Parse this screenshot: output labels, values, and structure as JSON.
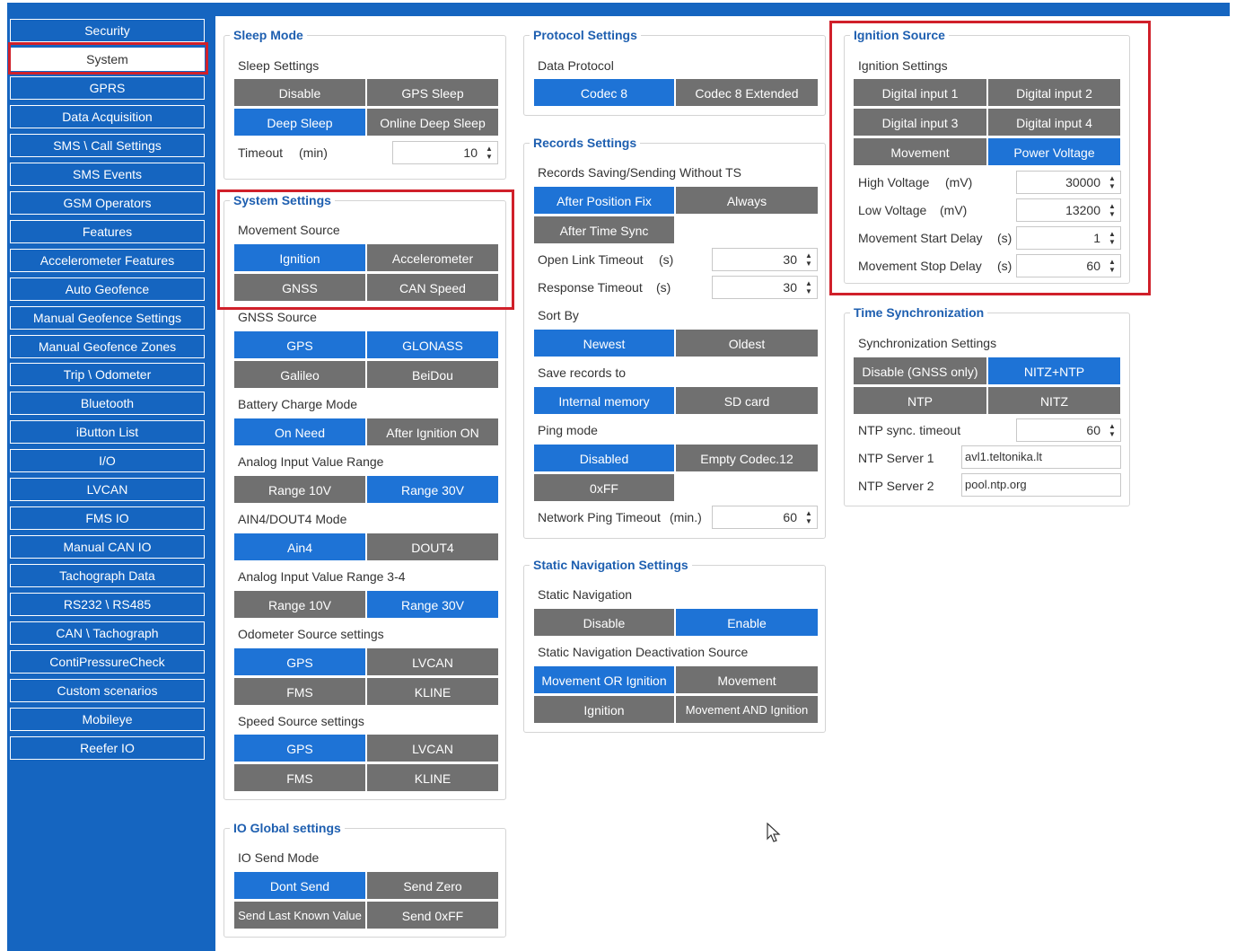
{
  "sidebar": {
    "items": [
      {
        "label": "Security"
      },
      {
        "label": "System",
        "active": true
      },
      {
        "label": "GPRS"
      },
      {
        "label": "Data Acquisition"
      },
      {
        "label": "SMS \\ Call Settings"
      },
      {
        "label": "SMS Events"
      },
      {
        "label": "GSM Operators"
      },
      {
        "label": "Features"
      },
      {
        "label": "Accelerometer Features"
      },
      {
        "label": "Auto Geofence"
      },
      {
        "label": "Manual Geofence Settings"
      },
      {
        "label": "Manual Geofence Zones"
      },
      {
        "label": "Trip \\ Odometer"
      },
      {
        "label": "Bluetooth"
      },
      {
        "label": "iButton List"
      },
      {
        "label": "I/O"
      },
      {
        "label": "LVCAN"
      },
      {
        "label": "FMS IO"
      },
      {
        "label": "Manual CAN IO"
      },
      {
        "label": "Tachograph Data"
      },
      {
        "label": "RS232 \\ RS485"
      },
      {
        "label": "CAN \\ Tachograph"
      },
      {
        "label": "ContiPressureCheck"
      },
      {
        "label": "Custom scenarios"
      },
      {
        "label": "Mobileye"
      },
      {
        "label": "Reefer IO"
      }
    ]
  },
  "sleep_mode": {
    "title": "Sleep Mode",
    "settings_label": "Sleep Settings",
    "options": [
      "Disable",
      "GPS Sleep",
      "Deep Sleep",
      "Online Deep Sleep"
    ],
    "selected": "Deep Sleep",
    "timeout_label": "Timeout",
    "timeout_unit": "(min)",
    "timeout_value": "10"
  },
  "system_settings": {
    "title": "System Settings",
    "movement_source_label": "Movement Source",
    "movement_source_options": [
      "Ignition",
      "Accelerometer",
      "GNSS",
      "CAN Speed"
    ],
    "movement_source_selected": "Ignition",
    "gnss_source_label": "GNSS Source",
    "gnss_source_options": [
      "GPS",
      "GLONASS",
      "Galileo",
      "BeiDou"
    ],
    "battery_label": "Battery Charge Mode",
    "battery_options": [
      "On Need",
      "After Ignition ON"
    ],
    "battery_selected": "On Need",
    "analog_range_label": "Analog Input Value Range",
    "analog_range_options": [
      "Range 10V",
      "Range 30V"
    ],
    "analog_range_selected": "Range 30V",
    "ain4_label": "AIN4/DOUT4 Mode",
    "ain4_options": [
      "Ain4",
      "DOUT4"
    ],
    "ain4_selected": "Ain4",
    "analog_range34_label": "Analog Input Value Range 3-4",
    "analog_range34_options": [
      "Range 10V",
      "Range 30V"
    ],
    "analog_range34_selected": "Range 30V",
    "odometer_label": "Odometer Source settings",
    "odometer_options": [
      "GPS",
      "LVCAN",
      "FMS",
      "KLINE"
    ],
    "odometer_selected": "GPS",
    "speed_label": "Speed Source settings",
    "speed_options": [
      "GPS",
      "LVCAN",
      "FMS",
      "KLINE"
    ],
    "speed_selected": "GPS"
  },
  "io_global": {
    "title": "IO Global settings",
    "send_mode_label": "IO Send Mode",
    "options": [
      "Dont Send",
      "Send Zero",
      "Send Last Known Value",
      "Send 0xFF"
    ],
    "selected": "Dont Send"
  },
  "protocol_settings": {
    "title": "Protocol Settings",
    "data_protocol_label": "Data Protocol",
    "options": [
      "Codec 8",
      "Codec 8 Extended"
    ],
    "selected": "Codec 8"
  },
  "records_settings": {
    "title": "Records Settings",
    "saving_label": "Records Saving/Sending Without TS",
    "saving_options": [
      "After Position Fix",
      "Always",
      "After Time Sync"
    ],
    "saving_selected": "After Position Fix",
    "open_link_label": "Open Link Timeout",
    "open_link_unit": "(s)",
    "open_link_value": "30",
    "response_label": "Response Timeout",
    "response_unit": "(s)",
    "response_value": "30",
    "sort_label": "Sort By",
    "sort_options": [
      "Newest",
      "Oldest"
    ],
    "sort_selected": "Newest",
    "save_to_label": "Save records to",
    "save_to_options": [
      "Internal memory",
      "SD card"
    ],
    "save_to_selected": "Internal memory",
    "ping_label": "Ping mode",
    "ping_options": [
      "Disabled",
      "Empty Codec.12",
      "0xFF"
    ],
    "ping_selected": "Disabled",
    "network_ping_label": "Network Ping Timeout",
    "network_ping_unit": "(min.)",
    "network_ping_value": "60"
  },
  "static_nav": {
    "title": "Static Navigation Settings",
    "label": "Static Navigation",
    "options": [
      "Disable",
      "Enable"
    ],
    "selected": "Enable",
    "deact_label": "Static Navigation Deactivation Source",
    "deact_options": [
      "Movement OR Ignition",
      "Movement",
      "Ignition",
      "Movement AND Ignition"
    ],
    "deact_selected": "Movement OR Ignition"
  },
  "ignition_source": {
    "title": "Ignition Source",
    "settings_label": "Ignition Settings",
    "options": [
      "Digital input 1",
      "Digital input 2",
      "Digital input 3",
      "Digital input 4",
      "Movement",
      "Power Voltage"
    ],
    "selected": "Power Voltage",
    "high_voltage_label": "High Voltage",
    "high_voltage_unit": "(mV)",
    "high_voltage_value": "30000",
    "low_voltage_label": "Low Voltage",
    "low_voltage_unit": "(mV)",
    "low_voltage_value": "13200",
    "move_start_label": "Movement Start Delay",
    "move_start_unit": "(s)",
    "move_start_value": "1",
    "move_stop_label": "Movement Stop Delay",
    "move_stop_unit": "(s)",
    "move_stop_value": "60"
  },
  "time_sync": {
    "title": "Time Synchronization",
    "settings_label": "Synchronization Settings",
    "options": [
      "Disable (GNSS only)",
      "NITZ+NTP",
      "NTP",
      "NITZ"
    ],
    "selected": "NITZ+NTP",
    "ntp_timeout_label": "NTP sync. timeout",
    "ntp_timeout_value": "60",
    "server1_label": "NTP Server 1",
    "server1_value": "avl1.teltonika.lt",
    "server2_label": "NTP Server 2",
    "server2_value": "pool.ntp.org"
  },
  "colors": {
    "accent": "#1e73d6",
    "sidebar": "#1565c0",
    "button_gray": "#707070",
    "highlight_red": "#d0202a"
  }
}
